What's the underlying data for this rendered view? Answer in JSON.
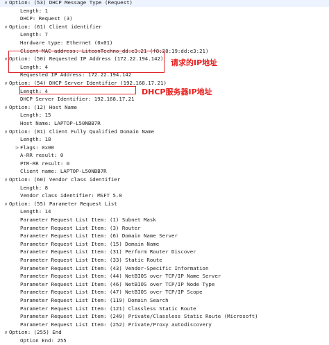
{
  "rows": [
    {
      "indent": 0,
      "toggle": "open",
      "text": "Option: (53) DHCP Message Type (Request)"
    },
    {
      "indent": 1,
      "toggle": "none",
      "text": "Length: 1"
    },
    {
      "indent": 1,
      "toggle": "none",
      "text": "DHCP: Request (3)"
    },
    {
      "indent": 0,
      "toggle": "open",
      "text": "Option: (61) Client identifier"
    },
    {
      "indent": 1,
      "toggle": "none",
      "text": "Length: 7"
    },
    {
      "indent": 1,
      "toggle": "none",
      "text": "Hardware type: Ethernet (0x01)"
    },
    {
      "indent": 1,
      "toggle": "none",
      "text": "Client MAC address: LiteonTechno_dd:e3:21 (f8:28:19:dd:e3:21)"
    },
    {
      "indent": 0,
      "toggle": "open",
      "text": "Option: (50) Requested IP Address (172.22.194.142)"
    },
    {
      "indent": 1,
      "toggle": "none",
      "text": "Length: 4"
    },
    {
      "indent": 1,
      "toggle": "none",
      "text": "Requested IP Address: 172.22.194.142"
    },
    {
      "indent": 0,
      "toggle": "open",
      "text": "Option: (54) DHCP Server Identifier (192.168.17.21)"
    },
    {
      "indent": 1,
      "toggle": "none",
      "text": "Length: 4"
    },
    {
      "indent": 1,
      "toggle": "none",
      "text": "DHCP Server Identifier: 192.168.17.21"
    },
    {
      "indent": 0,
      "toggle": "open",
      "text": "Option: (12) Host Name"
    },
    {
      "indent": 1,
      "toggle": "none",
      "text": "Length: 15"
    },
    {
      "indent": 1,
      "toggle": "none",
      "text": "Host Name: LAPTOP-L50NBB7R"
    },
    {
      "indent": 0,
      "toggle": "open",
      "text": "Option: (81) Client Fully Qualified Domain Name"
    },
    {
      "indent": 1,
      "toggle": "none",
      "text": "Length: 18"
    },
    {
      "indent": 1,
      "toggle": "closed",
      "text": "Flags: 0x00"
    },
    {
      "indent": 1,
      "toggle": "none",
      "text": "A-RR result: 0"
    },
    {
      "indent": 1,
      "toggle": "none",
      "text": "PTR-RR result: 0"
    },
    {
      "indent": 1,
      "toggle": "none",
      "text": "Client name: LAPTOP-L50NBB7R"
    },
    {
      "indent": 0,
      "toggle": "open",
      "text": "Option: (60) Vendor class identifier"
    },
    {
      "indent": 1,
      "toggle": "none",
      "text": "Length: 8"
    },
    {
      "indent": 1,
      "toggle": "none",
      "text": "Vendor class identifier: MSFT 5.0"
    },
    {
      "indent": 0,
      "toggle": "open",
      "text": "Option: (55) Parameter Request List"
    },
    {
      "indent": 1,
      "toggle": "none",
      "text": "Length: 14"
    },
    {
      "indent": 1,
      "toggle": "none",
      "text": "Parameter Request List Item: (1) Subnet Mask"
    },
    {
      "indent": 1,
      "toggle": "none",
      "text": "Parameter Request List Item: (3) Router"
    },
    {
      "indent": 1,
      "toggle": "none",
      "text": "Parameter Request List Item: (6) Domain Name Server"
    },
    {
      "indent": 1,
      "toggle": "none",
      "text": "Parameter Request List Item: (15) Domain Name"
    },
    {
      "indent": 1,
      "toggle": "none",
      "text": "Parameter Request List Item: (31) Perform Router Discover"
    },
    {
      "indent": 1,
      "toggle": "none",
      "text": "Parameter Request List Item: (33) Static Route"
    },
    {
      "indent": 1,
      "toggle": "none",
      "text": "Parameter Request List Item: (43) Vendor-Specific Information"
    },
    {
      "indent": 1,
      "toggle": "none",
      "text": "Parameter Request List Item: (44) NetBIOS over TCP/IP Name Server"
    },
    {
      "indent": 1,
      "toggle": "none",
      "text": "Parameter Request List Item: (46) NetBIOS over TCP/IP Node Type"
    },
    {
      "indent": 1,
      "toggle": "none",
      "text": "Parameter Request List Item: (47) NetBIOS over TCP/IP Scope"
    },
    {
      "indent": 1,
      "toggle": "none",
      "text": "Parameter Request List Item: (119) Domain Search"
    },
    {
      "indent": 1,
      "toggle": "none",
      "text": "Parameter Request List Item: (121) Classless Static Route"
    },
    {
      "indent": 1,
      "toggle": "none",
      "text": "Parameter Request List Item: (249) Private/Classless Static Route (Microsoft)"
    },
    {
      "indent": 1,
      "toggle": "none",
      "text": "Parameter Request List Item: (252) Private/Proxy autodiscovery"
    },
    {
      "indent": 0,
      "toggle": "open",
      "text": "Option: (255) End"
    },
    {
      "indent": 1,
      "toggle": "none",
      "text": "Option End: 255"
    }
  ],
  "annotations": {
    "requested_ip": "请求的IP地址",
    "server_id": "DHCP服务器IP地址"
  },
  "colors": {
    "highlight": "#e0262a",
    "annotation_text": "#e8201f"
  },
  "icons": {
    "open": "chevron-down-icon",
    "closed": "chevron-right-icon"
  }
}
